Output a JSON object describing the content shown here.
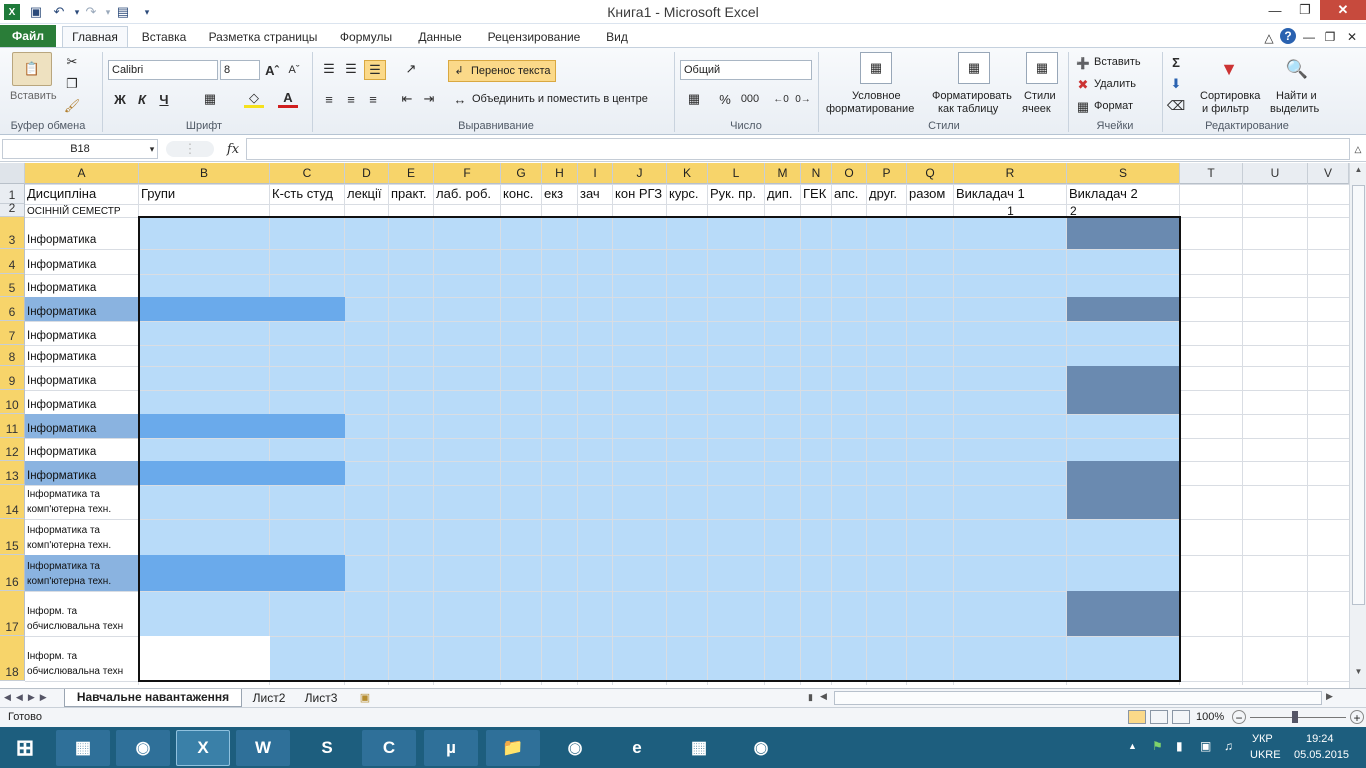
{
  "window": {
    "title": "Книга1  -  Microsoft Excel"
  },
  "tabs": [
    {
      "label": "Файл"
    },
    {
      "label": "Главная"
    },
    {
      "label": "Вставка"
    },
    {
      "label": "Разметка страницы"
    },
    {
      "label": "Формулы"
    },
    {
      "label": "Данные"
    },
    {
      "label": "Рецензирование"
    },
    {
      "label": "Вид"
    }
  ],
  "ribbon": {
    "clipboard": {
      "group": "Буфер обмена",
      "paste": "Вставить"
    },
    "font": {
      "group": "Шрифт",
      "family": "Calibri",
      "size": "8",
      "bold": "Ж",
      "italic": "К",
      "underline": "Ч"
    },
    "alignment": {
      "group": "Выравнивание",
      "wrap": "Перенос текста",
      "merge": "Объединить и поместить в центре"
    },
    "number": {
      "group": "Число",
      "format": "Общий",
      "percent": "%",
      "thousands": "000"
    },
    "styles": {
      "group": "Стили",
      "conditional": [
        "Условное",
        "форматирование"
      ],
      "as_table": [
        "Форматировать",
        "как таблицу"
      ],
      "cell_styles": [
        "Стили",
        "ячеек"
      ]
    },
    "cells": {
      "group": "Ячейки",
      "insert": "Вставить",
      "delete": "Удалить",
      "format": "Формат"
    },
    "editing": {
      "group": "Редактирование",
      "sort": [
        "Сортировка",
        "и фильтр"
      ],
      "find": [
        "Найти и",
        "выделить"
      ]
    }
  },
  "formula_bar": {
    "name_box": "B18",
    "fx": "fx",
    "formula": ""
  },
  "sheet": {
    "columns": [
      "A",
      "B",
      "C",
      "D",
      "E",
      "F",
      "G",
      "H",
      "I",
      "J",
      "K",
      "L",
      "M",
      "N",
      "O",
      "P",
      "Q",
      "R",
      "S",
      "T",
      "U",
      "V"
    ],
    "row_numbers": [
      "1",
      "2",
      "3",
      "4",
      "5",
      "6",
      "7",
      "8",
      "9",
      "10",
      "11",
      "12",
      "13",
      "14",
      "15",
      "16",
      "17",
      "18"
    ],
    "header_row": [
      "Дисципліна",
      "Групи",
      "К-сть студ",
      "лекції",
      "практ.",
      "лаб. роб.",
      "конс.",
      "екз",
      "зач",
      "кон РГЗ",
      "курс.",
      "Рук. пр.",
      "дип.",
      "ГЕК",
      "апс.",
      "друг.",
      "разом",
      "Викладач 1",
      "Викладач 2"
    ],
    "row2": {
      "a": "ОСІННІЙ СЕМЕСТР",
      "r": "1",
      "s": "2"
    },
    "disciplines": [
      [
        "Інформатика"
      ],
      [
        "Інформатика"
      ],
      [
        "Інформатика"
      ],
      [
        "Інформатика"
      ],
      [
        "Інформатика"
      ],
      [
        "Інформатика"
      ],
      [
        "Інформатика"
      ],
      [
        "Інформатика"
      ],
      [
        "Інформатика"
      ],
      [
        "Інформатика"
      ],
      [
        "Інформатика"
      ],
      [
        "Інформатика та",
        "комп'ютерна техн."
      ],
      [
        "Інформатика та",
        "комп'ютерна техн."
      ],
      [
        "Інформатика та",
        "комп'ютерна техн."
      ],
      [
        "Інформ. та",
        "обчислювальна техн"
      ],
      [
        "Інформ. та",
        "обчислювальна техн"
      ]
    ]
  },
  "sheet_tabs": [
    "Навчальне навантаження",
    "Лист2",
    "Лист3"
  ],
  "status": {
    "ready": "Готово",
    "zoom": "100%"
  },
  "taskbar": {
    "lang": "УКР",
    "lang2": "UKRE",
    "time": "19:24",
    "date": "05.05.2015"
  },
  "colors": {
    "selection": "#b8dbf9",
    "selection_dark": "#6aaaeb",
    "selection_slate": "#6a8ab0",
    "header_selected": "#f7d46a",
    "file_tab": "#2a7d38",
    "taskbar": "#1d5e7e"
  }
}
